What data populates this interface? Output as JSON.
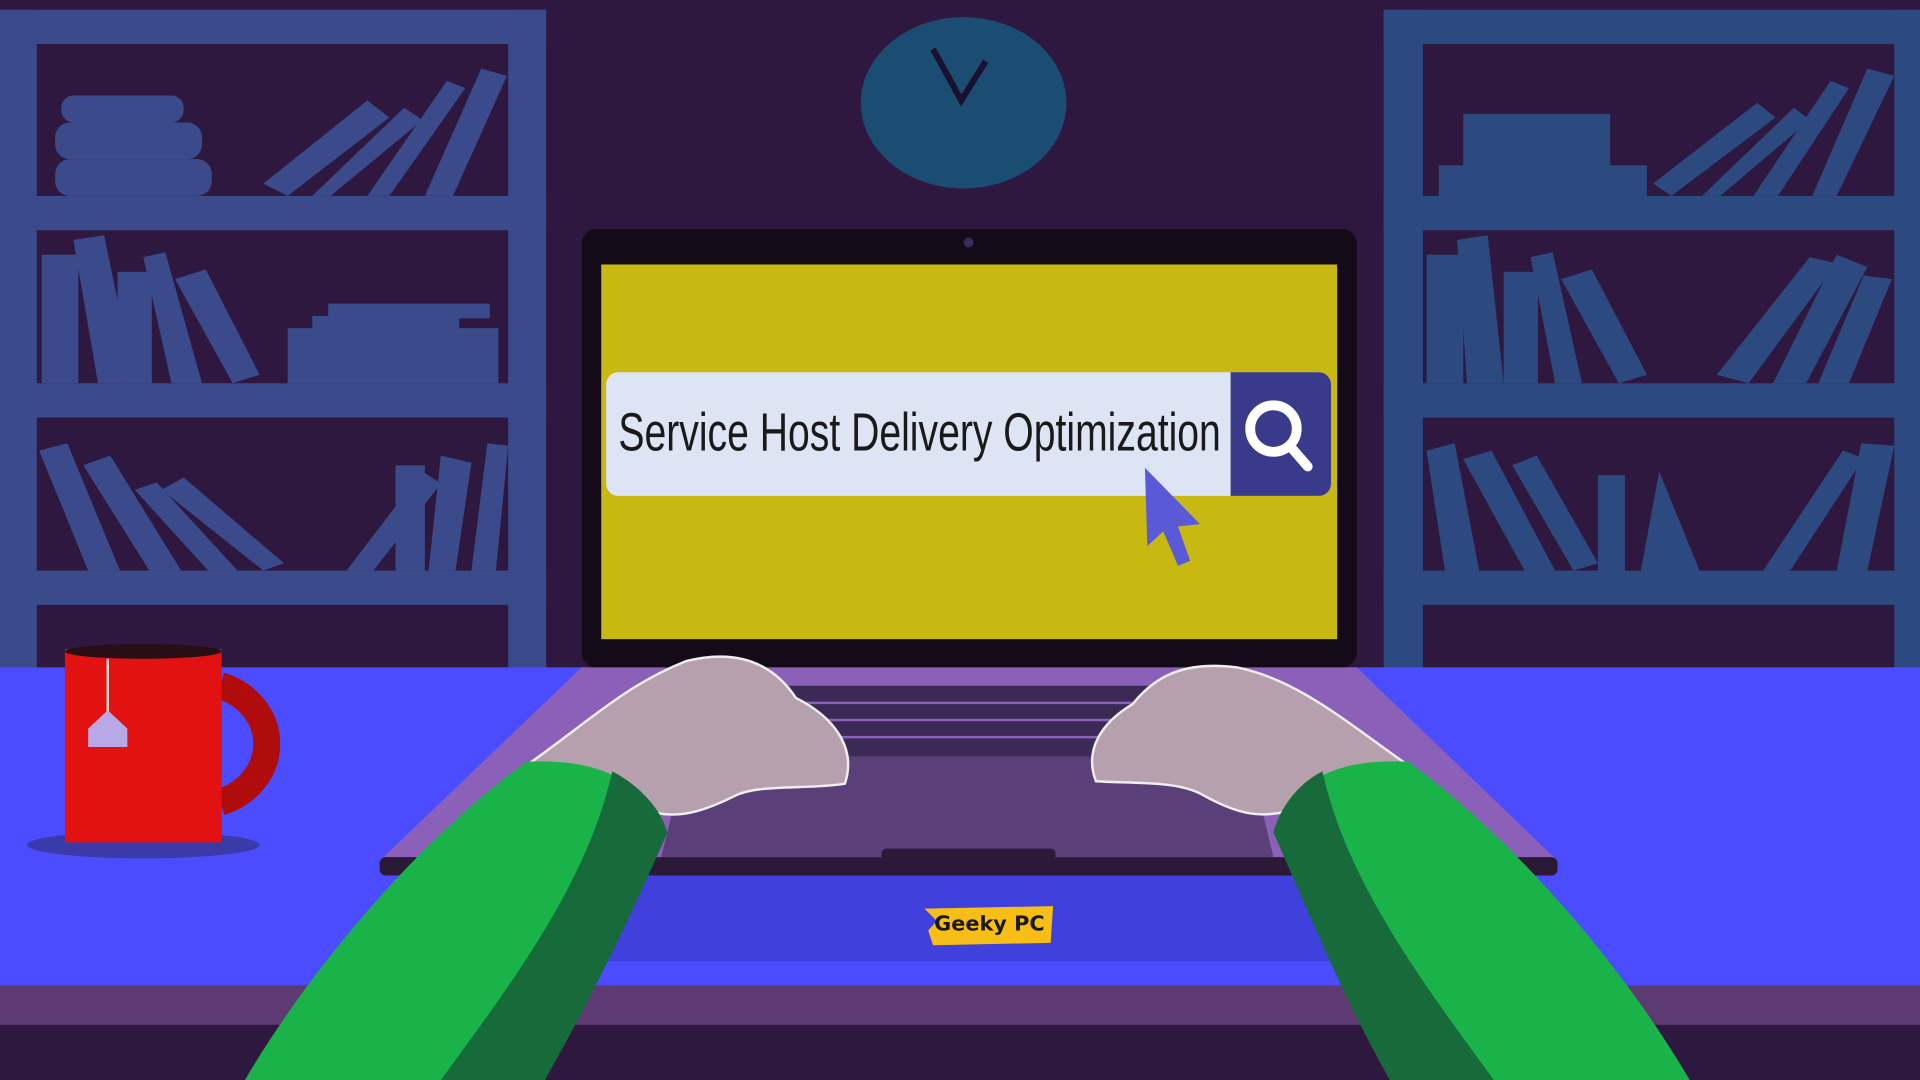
{
  "search": {
    "query": "Service Host Delivery Optimization",
    "icon": "search-icon"
  },
  "logo": {
    "text": "Geeky PC"
  },
  "colors": {
    "background": "#2e1840",
    "shelf": "#3a4a8a",
    "screen": "#c8b912",
    "desk": "#4b4cff",
    "sleeve": "#1ab34a",
    "mug": "#e31212"
  }
}
